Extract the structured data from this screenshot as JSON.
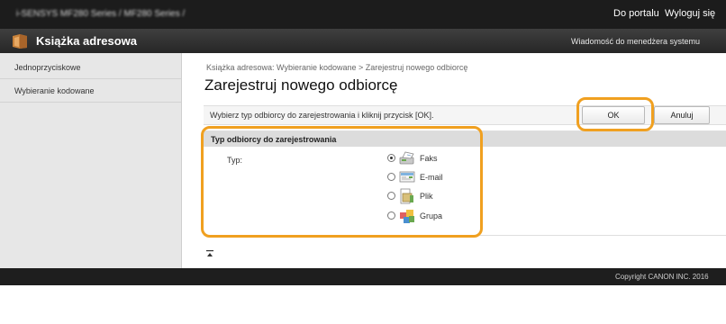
{
  "topbar": {
    "device_info": "i-SENSYS MF280 Series / MF280 Series /",
    "portal_link": "Do portalu",
    "logout_link": "Wyloguj się"
  },
  "titlebar": {
    "app_title": "Książka adresowa",
    "message_link": "Wiadomość do menedżera systemu",
    "icon": "address-book-icon"
  },
  "sidebar": {
    "items": [
      {
        "label": "Jednoprzyciskowe"
      },
      {
        "label": "Wybieranie kodowane"
      }
    ]
  },
  "main": {
    "breadcrumb": "Książka adresowa: Wybieranie kodowane > Zarejestruj nowego odbiorcę",
    "title": "Zarejestruj nowego odbiorcę",
    "instruction": "Wybierz typ odbiorcy do zarejestrowania i kliknij przycisk [OK].",
    "ok_label": "OK",
    "cancel_label": "Anuluj",
    "section": {
      "title": "Typ odbiorcy do zarejestrowania",
      "type_label": "Typ:",
      "options": [
        {
          "label": "Faks",
          "icon": "fax-icon",
          "selected": true
        },
        {
          "label": "E-mail",
          "icon": "email-icon",
          "selected": false
        },
        {
          "label": "Plik",
          "icon": "file-icon",
          "selected": false
        },
        {
          "label": "Grupa",
          "icon": "group-icon",
          "selected": false
        }
      ]
    },
    "back_to_top_icon": "back-to-top-icon"
  },
  "footer": {
    "copyright": "Copyright CANON INC. 2016"
  },
  "colors": {
    "highlight": "#f0a020",
    "topbar": "#1c1c1c",
    "titlebar": "#2e2e2e",
    "sidebar": "#e7e7e7",
    "section_header": "#dcdcdc"
  }
}
